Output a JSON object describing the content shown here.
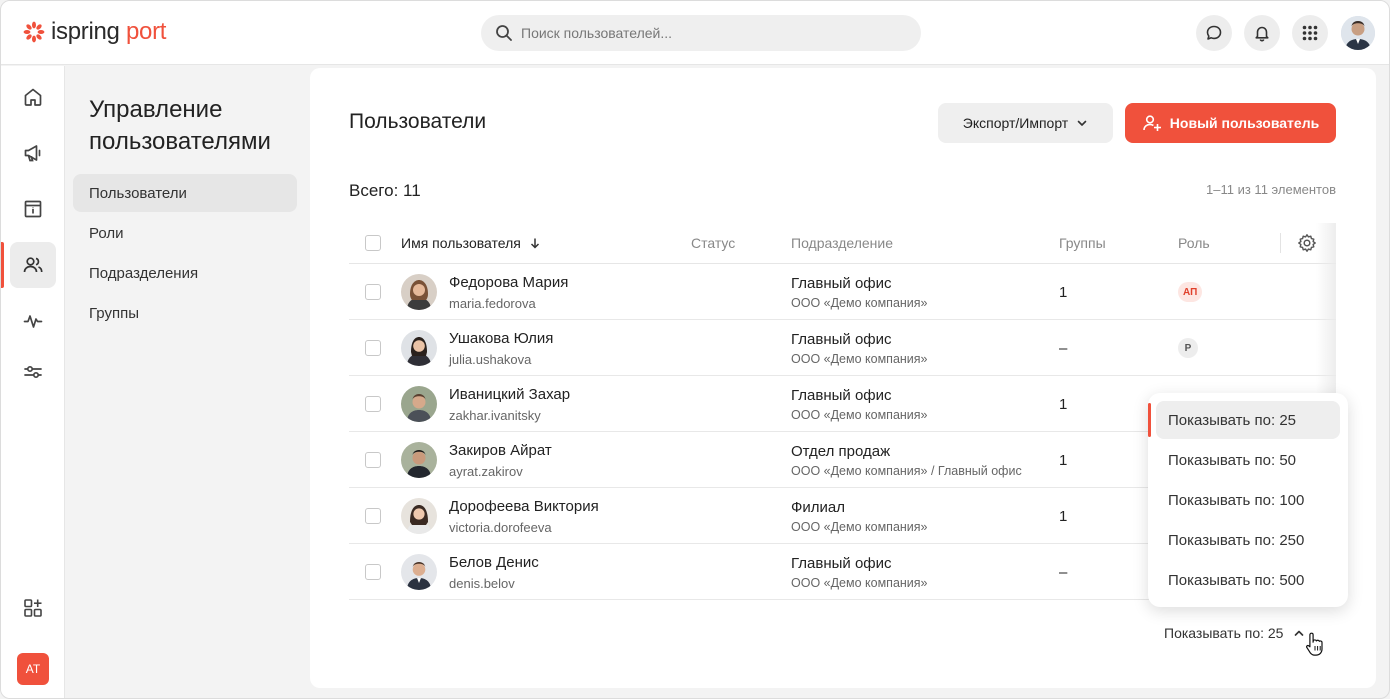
{
  "app": {
    "logo_part1": "ispring",
    "logo_part2": " port",
    "brand_color": "#f0513c"
  },
  "search": {
    "placeholder": "Поиск пользователей..."
  },
  "header_icons": [
    "chat-icon",
    "bell-icon",
    "apps-grid-icon",
    "user-avatar"
  ],
  "rail": {
    "items": [
      "home-icon",
      "megaphone-icon",
      "catalog-icon",
      "users-icon",
      "activity-icon",
      "settings-sliders-icon"
    ],
    "active": "users-icon",
    "bottom": [
      "add-apps-icon"
    ],
    "account_initials": "AT"
  },
  "sidebar": {
    "title": "Управление пользователями",
    "items": [
      {
        "label": "Пользователи",
        "active": true
      },
      {
        "label": "Роли",
        "active": false
      },
      {
        "label": "Подразделения",
        "active": false
      },
      {
        "label": "Группы",
        "active": false
      }
    ]
  },
  "main": {
    "title": "Пользователи",
    "export_label": "Экспорт/Импорт",
    "new_user_label": "Новый пользователь",
    "total_label": "Всего: 11",
    "range_label": "1–11 из 11 элементов",
    "columns": {
      "name": "Имя пользователя",
      "status": "Статус",
      "dept": "Подразделение",
      "groups": "Группы",
      "role": "Роль"
    },
    "rows": [
      {
        "name": "Федорова Мария",
        "login": "maria.fedorova",
        "dept": "Главный офис",
        "org": "ООО «Демо компания»",
        "groups": "1",
        "role": "АП",
        "role_kind": "ap"
      },
      {
        "name": "Ушакова Юлия",
        "login": "julia.ushakova",
        "dept": "Главный офис",
        "org": "ООО «Демо компания»",
        "groups": "–",
        "role": "Р",
        "role_kind": "r"
      },
      {
        "name": "Иваницкий Захар",
        "login": "zakhar.ivanitsky",
        "dept": "Главный офис",
        "org": "ООО «Демо компания»",
        "groups": "1",
        "role": "",
        "role_kind": ""
      },
      {
        "name": "Закиров Айрат",
        "login": "ayrat.zakirov",
        "dept": "Отдел продаж",
        "org": "ООО «Демо компания» / Главный офис",
        "groups": "1",
        "role": "",
        "role_kind": ""
      },
      {
        "name": "Дорофеева Виктория",
        "login": "victoria.dorofeeva",
        "dept": "Филиал",
        "org": "ООО «Демо компания»",
        "groups": "1",
        "role": "",
        "role_kind": ""
      },
      {
        "name": "Белов Денис",
        "login": "denis.belov",
        "dept": "Главный офис",
        "org": "ООО «Демо компания»",
        "groups": "–",
        "role": "",
        "role_kind": ""
      }
    ],
    "page_size_label": "Показывать по: 25"
  },
  "page_size_menu": {
    "options": [
      "Показывать по: 25",
      "Показывать по: 50",
      "Показывать по: 100",
      "Показывать по: 250",
      "Показывать по: 500"
    ],
    "selected": "Показывать по: 25"
  }
}
